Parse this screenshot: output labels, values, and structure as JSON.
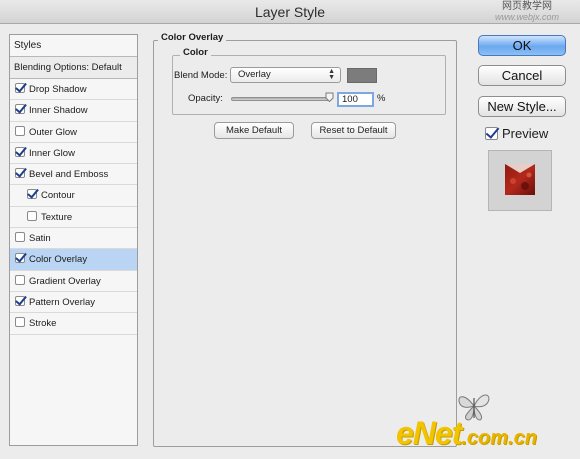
{
  "window": {
    "title": "Layer Style"
  },
  "watermark_top": {
    "zh": "网页教学网",
    "url": "www.webjx.com"
  },
  "watermark_bottom": {
    "brand": "eNet",
    "suffix": ".com.cn"
  },
  "styles_list": {
    "header": "Styles",
    "blending": "Blending Options: Default",
    "items": [
      {
        "label": "Drop Shadow",
        "checked": true
      },
      {
        "label": "Inner Shadow",
        "checked": true
      },
      {
        "label": "Outer Glow",
        "checked": false
      },
      {
        "label": "Inner Glow",
        "checked": true
      },
      {
        "label": "Bevel and Emboss",
        "checked": true
      },
      {
        "label": "Contour",
        "checked": true
      },
      {
        "label": "Texture",
        "checked": false
      },
      {
        "label": "Satin",
        "checked": false
      },
      {
        "label": "Color Overlay",
        "checked": true,
        "selected": true
      },
      {
        "label": "Gradient Overlay",
        "checked": false
      },
      {
        "label": "Pattern Overlay",
        "checked": true
      },
      {
        "label": "Stroke",
        "checked": false
      }
    ]
  },
  "panel": {
    "title": "Color Overlay",
    "group": "Color",
    "blend_mode_label": "Blend Mode:",
    "blend_mode_value": "Overlay",
    "swatch_color": "#7c7c7c",
    "opacity_label": "Opacity:",
    "opacity_value": "100",
    "opacity_unit": "%",
    "opacity_level": 1.0,
    "make_default": "Make Default",
    "reset_default": "Reset to Default"
  },
  "buttons": {
    "ok": "OK",
    "cancel": "Cancel",
    "new_style": "New Style...",
    "preview": "Preview",
    "preview_checked": true
  },
  "colors": {
    "selection": "#b9d5f3",
    "primary_button": "#6aa8ee",
    "checkmark": "#1f3f8a"
  }
}
